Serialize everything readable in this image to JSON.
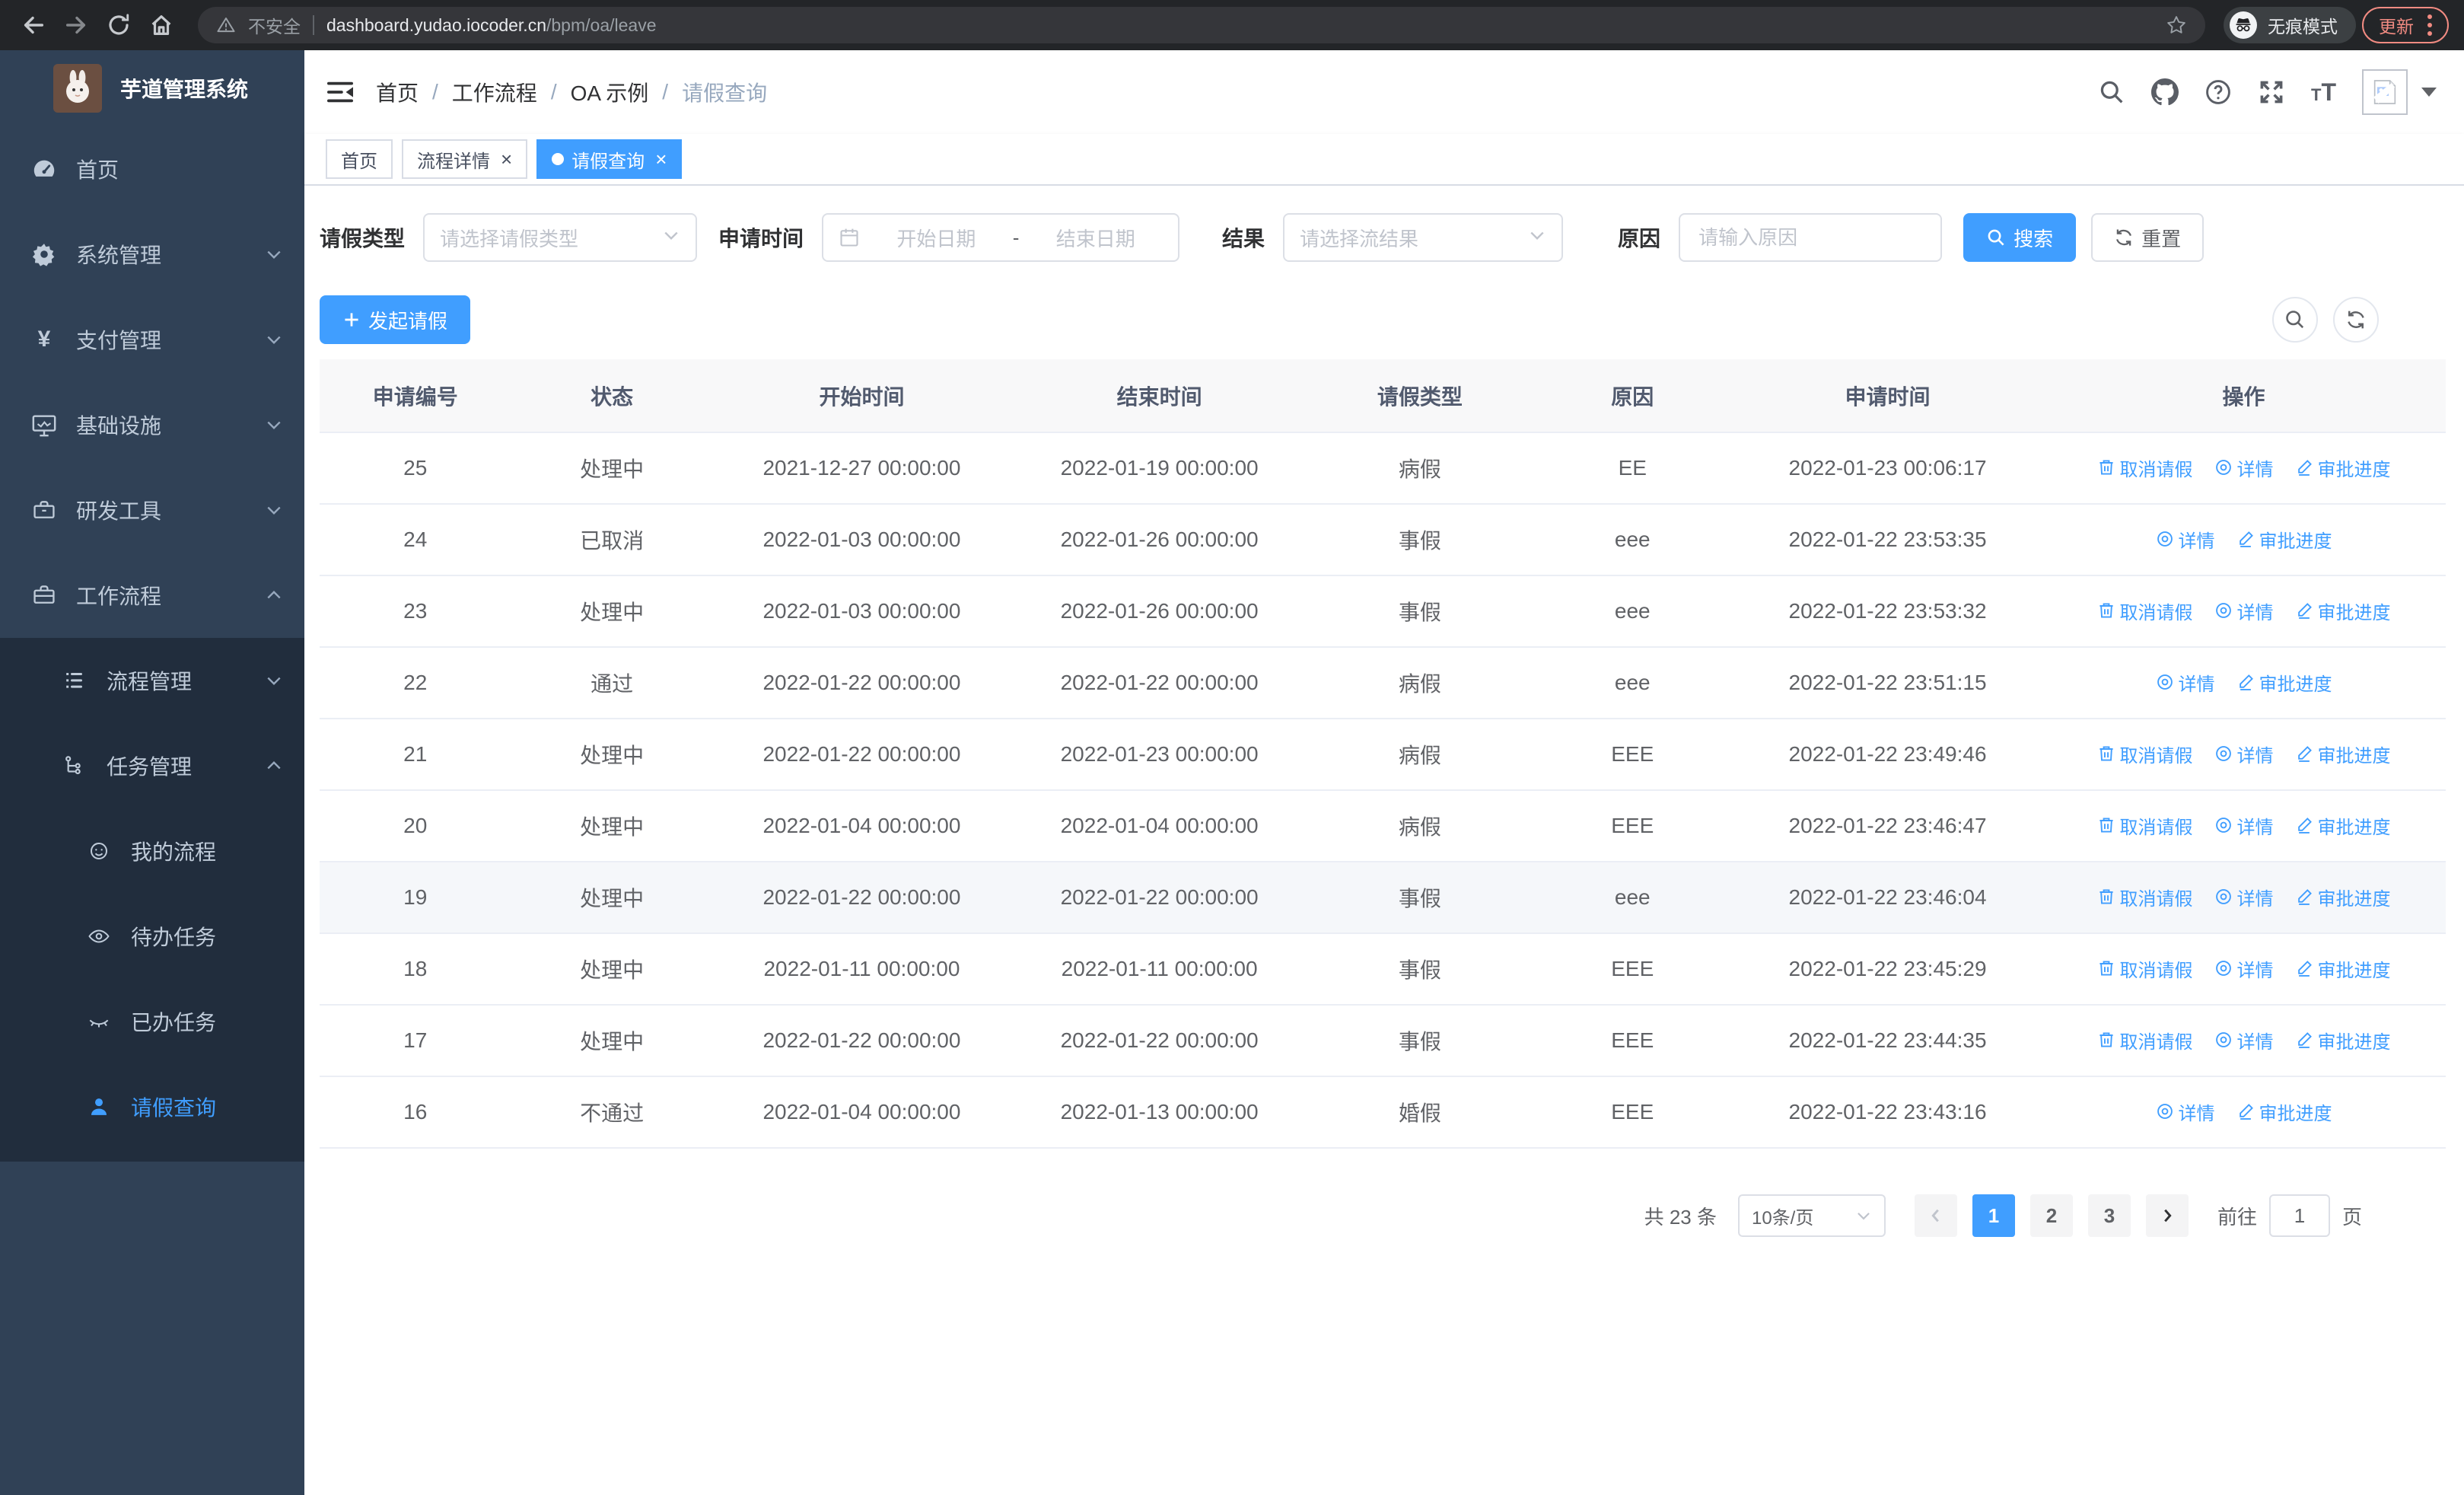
{
  "browser": {
    "security_label": "不安全",
    "url_host": "dashboard.yudao.iocoder.cn",
    "url_path": "/bpm/oa/leave",
    "incognito_label": "无痕模式",
    "update_label": "更新"
  },
  "sidebar": {
    "title": "芋道管理系统",
    "items": [
      {
        "key": "home",
        "label": "首页",
        "icon": "dashboard-icon"
      },
      {
        "key": "system",
        "label": "系统管理",
        "icon": "gear-icon",
        "chevron": "down"
      },
      {
        "key": "payment",
        "label": "支付管理",
        "icon": "yen-icon",
        "chevron": "down"
      },
      {
        "key": "infra",
        "label": "基础设施",
        "icon": "monitor-icon",
        "chevron": "down"
      },
      {
        "key": "devtools",
        "label": "研发工具",
        "icon": "toolbox-icon",
        "chevron": "down"
      },
      {
        "key": "workflow",
        "label": "工作流程",
        "icon": "briefcase-icon",
        "chevron": "up",
        "expanded": true,
        "children": [
          {
            "key": "process-mgmt",
            "label": "流程管理",
            "icon": "list-icon",
            "chevron": "down"
          },
          {
            "key": "task-mgmt",
            "label": "任务管理",
            "icon": "tree-icon",
            "chevron": "up",
            "expanded": true,
            "children": [
              {
                "key": "my-process",
                "label": "我的流程",
                "icon": "face-icon"
              },
              {
                "key": "todo-task",
                "label": "待办任务",
                "icon": "eye-open-icon"
              },
              {
                "key": "done-task",
                "label": "已办任务",
                "icon": "eye-closed-icon"
              },
              {
                "key": "leave-query",
                "label": "请假查询",
                "icon": "user-icon",
                "active": true
              }
            ]
          }
        ]
      }
    ]
  },
  "breadcrumb": {
    "items": [
      {
        "label": "首页"
      },
      {
        "label": "工作流程"
      },
      {
        "label": "OA 示例"
      },
      {
        "label": "请假查询",
        "current": true
      }
    ]
  },
  "header_icon_names": [
    "search-icon",
    "github-icon",
    "help-icon",
    "fullscreen-icon",
    "font-size-icon",
    "avatar-broken-image-icon",
    "caret-down-icon"
  ],
  "tabs": [
    {
      "key": "home",
      "label": "首页",
      "closable": false,
      "active": false
    },
    {
      "key": "process-detail",
      "label": "流程详情",
      "closable": true,
      "active": false
    },
    {
      "key": "leave-query",
      "label": "请假查询",
      "closable": true,
      "active": true
    }
  ],
  "filters": {
    "leave_type_label": "请假类型",
    "leave_type_placeholder": "请选择请假类型",
    "apply_time_label": "申请时间",
    "start_placeholder": "开始日期",
    "range_separator": "-",
    "end_placeholder": "结束日期",
    "result_label": "结果",
    "result_placeholder": "请选择流结果",
    "reason_label": "原因",
    "reason_placeholder": "请输入原因",
    "search_label": "搜索",
    "reset_label": "重置"
  },
  "toolbar": {
    "create_label": "发起请假"
  },
  "table": {
    "columns": [
      "申请编号",
      "状态",
      "开始时间",
      "结束时间",
      "请假类型",
      "原因",
      "申请时间",
      "操作"
    ],
    "action_labels": {
      "cancel": "取消请假",
      "detail": "详情",
      "progress": "审批进度"
    },
    "rows": [
      {
        "id": "25",
        "status": "处理中",
        "start": "2021-12-27 00:00:00",
        "end": "2022-01-19 00:00:00",
        "type": "病假",
        "reason": "EE",
        "apply_time": "2022-01-23 00:06:17",
        "actions": [
          "cancel",
          "detail",
          "progress"
        ],
        "highlight": false
      },
      {
        "id": "24",
        "status": "已取消",
        "start": "2022-01-03 00:00:00",
        "end": "2022-01-26 00:00:00",
        "type": "事假",
        "reason": "eee",
        "apply_time": "2022-01-22 23:53:35",
        "actions": [
          "detail",
          "progress"
        ],
        "highlight": false
      },
      {
        "id": "23",
        "status": "处理中",
        "start": "2022-01-03 00:00:00",
        "end": "2022-01-26 00:00:00",
        "type": "事假",
        "reason": "eee",
        "apply_time": "2022-01-22 23:53:32",
        "actions": [
          "cancel",
          "detail",
          "progress"
        ],
        "highlight": false
      },
      {
        "id": "22",
        "status": "通过",
        "start": "2022-01-22 00:00:00",
        "end": "2022-01-22 00:00:00",
        "type": "病假",
        "reason": "eee",
        "apply_time": "2022-01-22 23:51:15",
        "actions": [
          "detail",
          "progress"
        ],
        "highlight": false
      },
      {
        "id": "21",
        "status": "处理中",
        "start": "2022-01-22 00:00:00",
        "end": "2022-01-23 00:00:00",
        "type": "病假",
        "reason": "EEE",
        "apply_time": "2022-01-22 23:49:46",
        "actions": [
          "cancel",
          "detail",
          "progress"
        ],
        "highlight": false
      },
      {
        "id": "20",
        "status": "处理中",
        "start": "2022-01-04 00:00:00",
        "end": "2022-01-04 00:00:00",
        "type": "病假",
        "reason": "EEE",
        "apply_time": "2022-01-22 23:46:47",
        "actions": [
          "cancel",
          "detail",
          "progress"
        ],
        "highlight": false
      },
      {
        "id": "19",
        "status": "处理中",
        "start": "2022-01-22 00:00:00",
        "end": "2022-01-22 00:00:00",
        "type": "事假",
        "reason": "eee",
        "apply_time": "2022-01-22 23:46:04",
        "actions": [
          "cancel",
          "detail",
          "progress"
        ],
        "highlight": true
      },
      {
        "id": "18",
        "status": "处理中",
        "start": "2022-01-11 00:00:00",
        "end": "2022-01-11 00:00:00",
        "type": "事假",
        "reason": "EEE",
        "apply_time": "2022-01-22 23:45:29",
        "actions": [
          "cancel",
          "detail",
          "progress"
        ],
        "highlight": false
      },
      {
        "id": "17",
        "status": "处理中",
        "start": "2022-01-22 00:00:00",
        "end": "2022-01-22 00:00:00",
        "type": "事假",
        "reason": "EEE",
        "apply_time": "2022-01-22 23:44:35",
        "actions": [
          "cancel",
          "detail",
          "progress"
        ],
        "highlight": false
      },
      {
        "id": "16",
        "status": "不通过",
        "start": "2022-01-04 00:00:00",
        "end": "2022-01-13 00:00:00",
        "type": "婚假",
        "reason": "EEE",
        "apply_time": "2022-01-22 23:43:16",
        "actions": [
          "detail",
          "progress"
        ],
        "highlight": false
      }
    ]
  },
  "pagination": {
    "total_text": "共 23 条",
    "page_size_text": "10条/页",
    "pages": [
      "1",
      "2",
      "3"
    ],
    "active_page": "1",
    "goto_label": "前往",
    "goto_value": "1",
    "page_unit": "页"
  },
  "colors": {
    "accent": "#409eff",
    "sidebar_bg": "#304156",
    "submenu_bg": "#212d3d",
    "update_button_accent": "#f28b82",
    "table_header_bg": "#f8f8f9",
    "highlight_row_bg": "#f5f7fa"
  }
}
